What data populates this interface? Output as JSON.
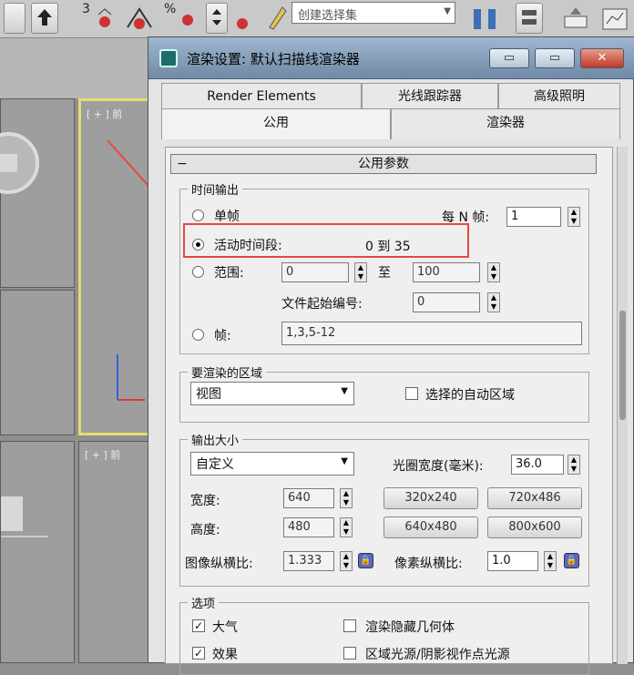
{
  "toolbar": {
    "num1": "3",
    "num2": "%",
    "selection_placeholder": "创建选择集"
  },
  "viewports": {
    "label_right_top": "[ + ] 前",
    "label_left_bottom": "[ + ] 前"
  },
  "dialog": {
    "title": "渲染设置: 默认扫描线渲染器",
    "window_buttons": {
      "minimize": "▭",
      "restore": "▭",
      "close": "✕"
    },
    "tabs_row1": [
      "Render Elements",
      "光线跟踪器",
      "高级照明"
    ],
    "tabs_row2": [
      "公用",
      "渲染器"
    ],
    "rollout_title": "公用参数",
    "time_output": {
      "title": "时间输出",
      "single": "单帧",
      "every_n": "每 N 帧:",
      "every_n_value": "1",
      "active_segment": "活动时间段:",
      "active_range": "0 到 35",
      "range": "范围:",
      "range_from": "0",
      "range_to_label": "至",
      "range_to": "100",
      "file_start": "文件起始编号:",
      "file_start_value": "0",
      "frames": "帧:",
      "frames_value": "1,3,5-12"
    },
    "render_area": {
      "title": "要渲染的区域",
      "select_value": "视图",
      "auto_region": "选择的自动区域"
    },
    "output_size": {
      "title": "输出大小",
      "preset": "自定义",
      "aperture_label": "光圈宽度(毫米):",
      "aperture_value": "36.0",
      "width_label": "宽度:",
      "width_value": "640",
      "height_label": "高度:",
      "height_value": "480",
      "presets": [
        "320x240",
        "720x486",
        "640x480",
        "800x600"
      ],
      "image_aspect_label": "图像纵横比:",
      "image_aspect_value": "1.333",
      "pixel_aspect_label": "像素纵横比:",
      "pixel_aspect_value": "1.0"
    },
    "options": {
      "title": "选项",
      "atmosphere": "大气",
      "render_hidden": "渲染隐藏几何体",
      "effects": "效果",
      "area_lights": "区域光源/阴影视作点光源"
    }
  },
  "colors": {
    "highlight": "#e24a40",
    "viewport_active_border": "#e6dc6e"
  }
}
